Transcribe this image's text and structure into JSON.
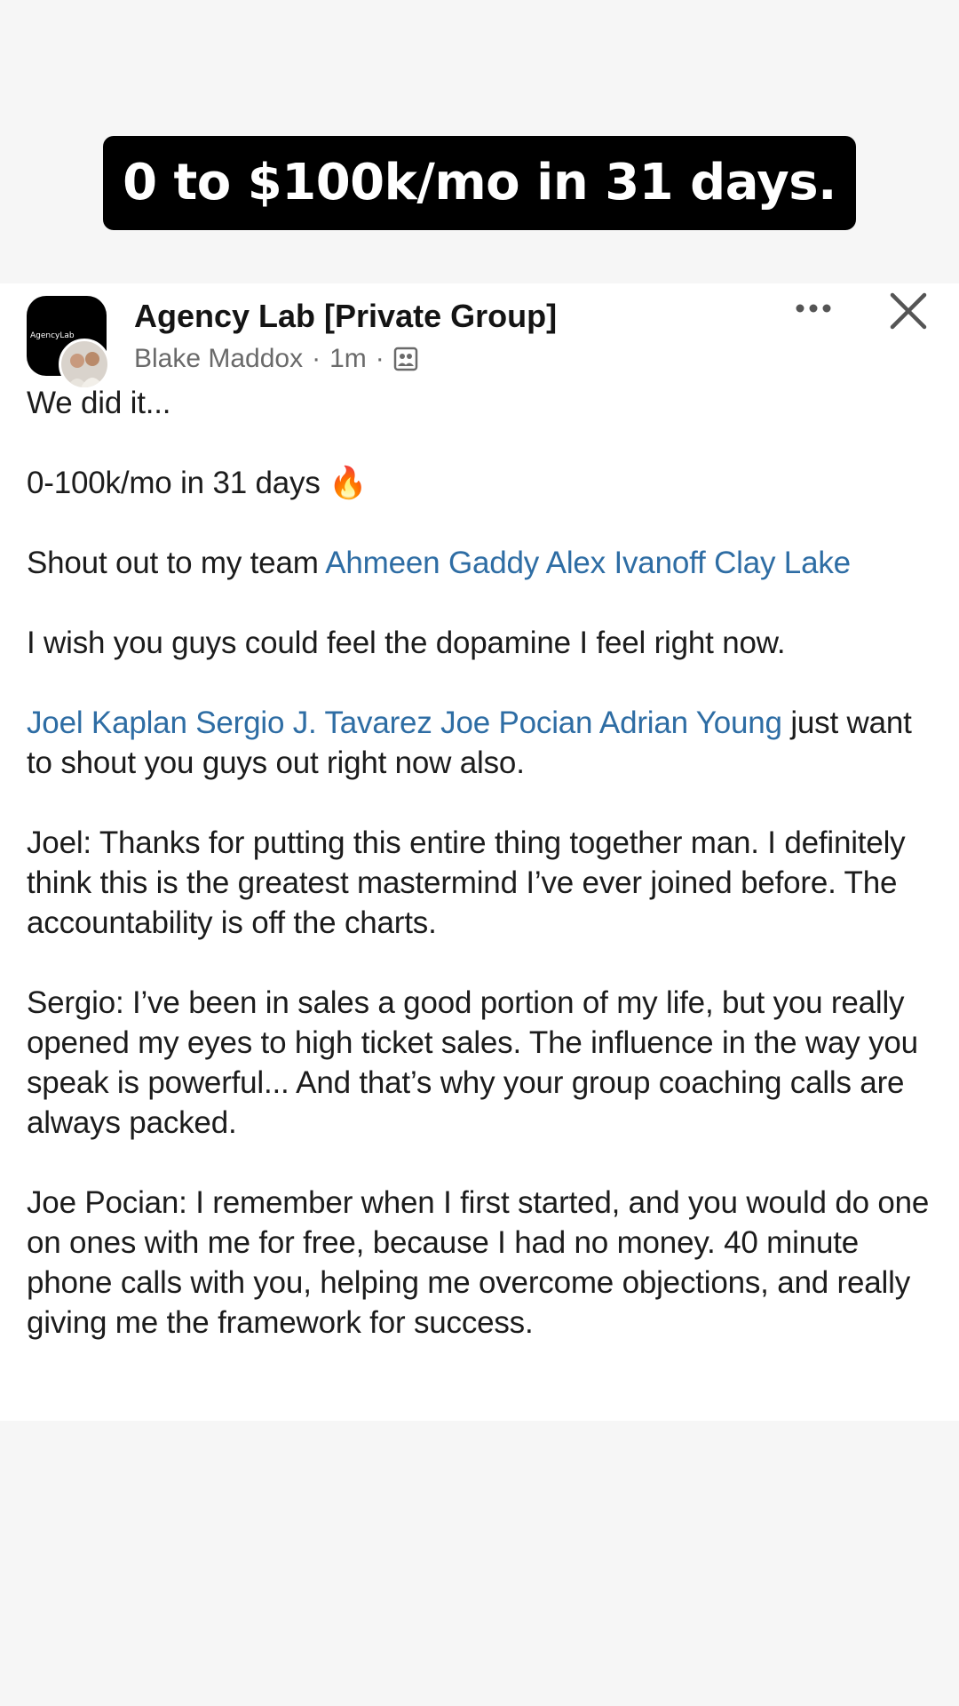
{
  "banner": {
    "text": "0 to $100k/mo in 31 days."
  },
  "post": {
    "group_name": "Agency Lab [Private Group]",
    "group_avatar_text": "AgencyLab",
    "author": "Blake Maddox",
    "separator": "·",
    "time": "1m",
    "audience_icon": "members-icon",
    "paragraphs": {
      "p1": "We did it...",
      "p2_text": "0-100k/mo in 31 days",
      "p2_emoji": "🔥",
      "p3_prefix": "Shout out to my team",
      "p3_mentions": [
        "Ahmeen Gaddy",
        "Alex Ivanoff",
        "Clay Lake"
      ],
      "p4": "I wish you guys could feel the dopamine I feel right now.",
      "p5_mentions": [
        "Joel Kaplan",
        "Sergio J. Tavarez",
        "Joe Pocian",
        "Adrian Young"
      ],
      "p5_suffix": "just want to shout you guys out right now also.",
      "p6": "Joel: Thanks for putting this entire thing together man. I definitely think this is the greatest mastermind I’ve ever joined before. The accountability is off the charts.",
      "p7": "Sergio: I’ve been in sales a good portion of my life, but you really opened my eyes to high ticket sales. The influence in the way you speak is powerful... And that’s why your group coaching calls are always packed.",
      "p8": "Joe Pocian: I remember when I first started, and you would do one on ones with me for free, because I had no money. 40 minute phone calls with you, helping me overcome objections, and really giving me the framework for success."
    }
  },
  "colors": {
    "mention": "#2e6da4",
    "banner_bg": "#000000",
    "fire": "#f5a623"
  }
}
